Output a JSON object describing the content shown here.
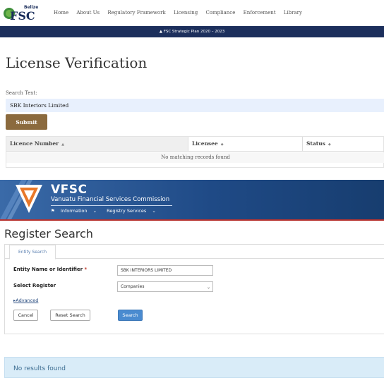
{
  "belize": {
    "logo": {
      "top_text": "Belize",
      "main_text": "FSC"
    },
    "nav": [
      "Home",
      "About Us",
      "Regulatory Framework",
      "Licensing",
      "Compliance",
      "Enforcement",
      "Library"
    ],
    "banner": "FSC Strategic Plan 2020 – 2023",
    "page_title": "License Verification",
    "search": {
      "label": "Search Text:",
      "value": "SBK Interiors Limited"
    },
    "submit_label": "Submit",
    "table": {
      "columns": [
        "Licence Number",
        "Licensee",
        "Status"
      ],
      "empty_message": "No matching records found"
    }
  },
  "vanuatu": {
    "brand": {
      "title": "VFSC",
      "subtitle": "Vanuatu Financial Services Commission"
    },
    "nav": {
      "home_icon": "home-icon",
      "items": [
        "Information",
        "Registry Services"
      ]
    },
    "colors": {
      "accent": "#e8782a",
      "header": "#1f4a86",
      "redline": "#b8322e"
    },
    "page_title": "Register Search",
    "tab_label": "Entity Search",
    "form": {
      "entity_label": "Entity Name or Identifier",
      "required_mark": "*",
      "entity_value": "SBK INTERIORS LIMITED",
      "register_label": "Select Register",
      "register_value": "Companies",
      "advanced_label": "Advanced",
      "cancel_label": "Cancel",
      "reset_label": "Reset Search",
      "search_label": "Search"
    },
    "results_message": "No results found"
  }
}
